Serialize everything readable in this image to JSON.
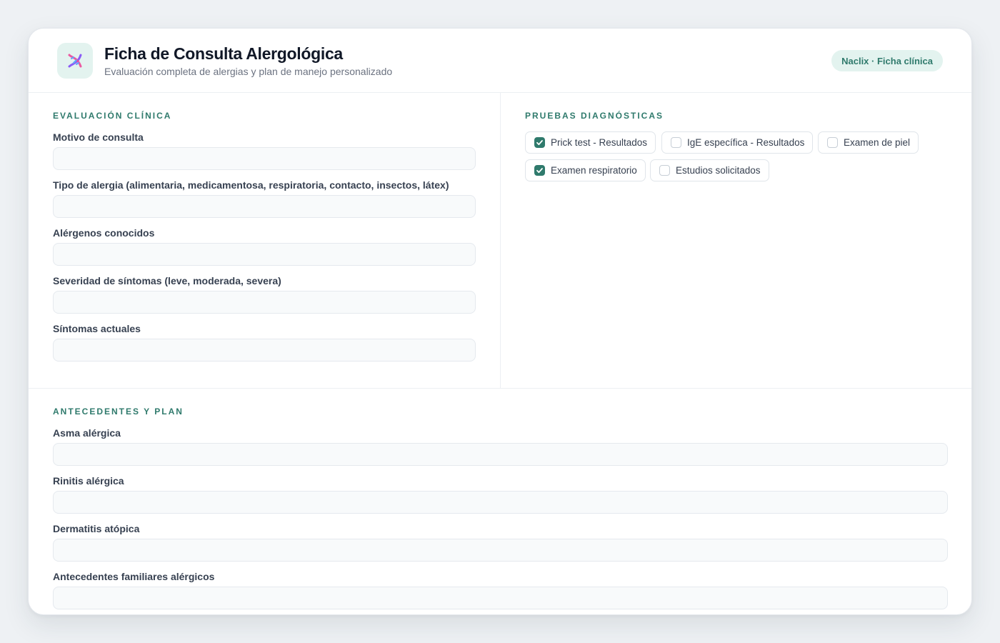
{
  "header": {
    "app_icon": "dna-icon",
    "title": "Ficha de Consulta Alergológica",
    "subtitle": "Evaluación completa de alergias y plan de manejo personalizado",
    "badge": "Naclix · Ficha clínica"
  },
  "clinical": {
    "section_title": "EVALUACIÓN CLÍNICA",
    "fields": [
      {
        "label": "Motivo de consulta",
        "value": "",
        "placeholder": ""
      },
      {
        "label": "Tipo de alergia (alimentaria, medicamentosa, respiratoria, contacto, insectos, látex)",
        "value": "",
        "placeholder": ""
      },
      {
        "label": "Alérgenos conocidos",
        "value": "",
        "placeholder": ""
      },
      {
        "label": "Severidad de síntomas (leve, moderada, severa)",
        "value": "",
        "placeholder": ""
      },
      {
        "label": "Síntomas actuales",
        "value": "",
        "placeholder": ""
      }
    ]
  },
  "tests": {
    "section_title": "PRUEBAS DIAGNÓSTICAS",
    "options": [
      {
        "label": "Prick test - Resultados",
        "checked": true
      },
      {
        "label": "IgE específica - Resultados",
        "checked": false
      },
      {
        "label": "Examen de piel",
        "checked": false
      },
      {
        "label": "Examen respiratorio",
        "checked": true
      },
      {
        "label": "Estudios solicitados",
        "checked": false
      }
    ]
  },
  "history": {
    "section_title": "ANTECEDENTES Y PLAN",
    "fields": [
      {
        "label": "Asma alérgica",
        "value": "",
        "placeholder": ""
      },
      {
        "label": "Rinitis alérgica",
        "value": "",
        "placeholder": ""
      },
      {
        "label": "Dermatitis atópica",
        "value": "",
        "placeholder": ""
      },
      {
        "label": "Antecedentes familiares alérgicos",
        "value": "",
        "placeholder": ""
      }
    ]
  },
  "colors": {
    "accent": "#2f7a6c",
    "accent_soft": "#e3f3ef",
    "background": "#eef1f4"
  }
}
